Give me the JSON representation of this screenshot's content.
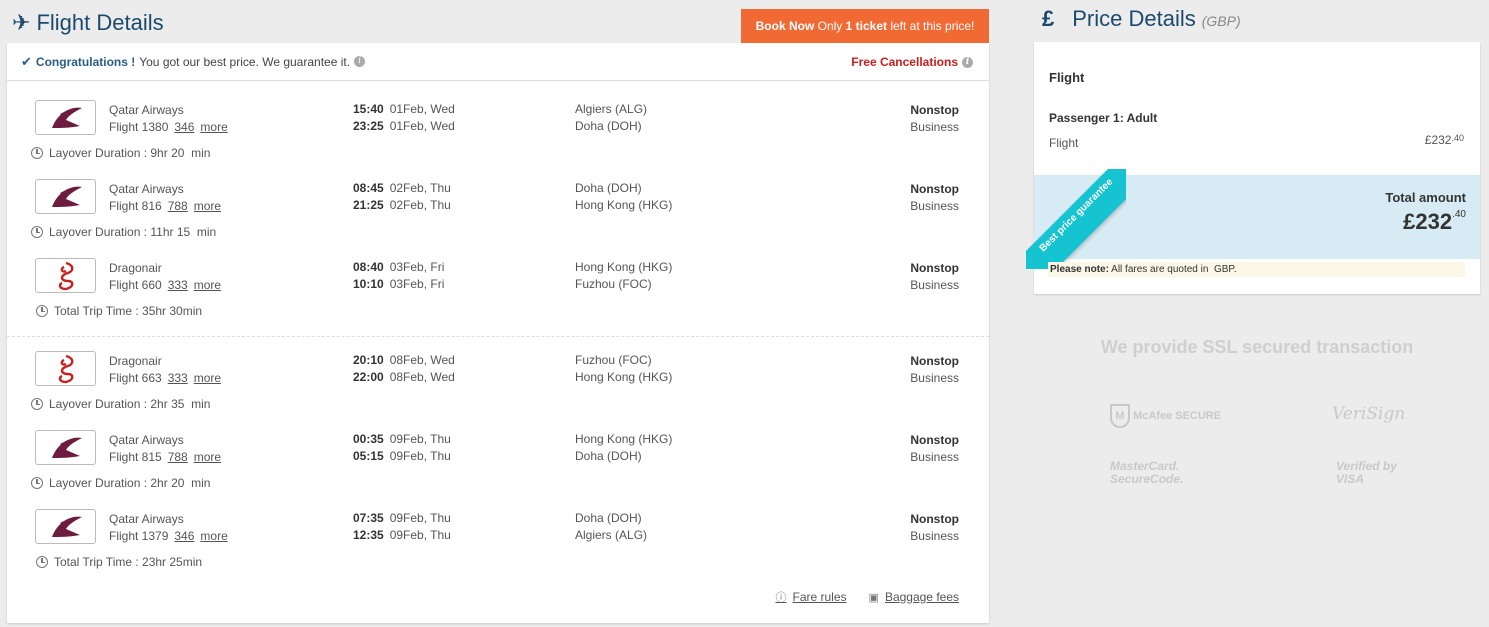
{
  "flight_details": {
    "title": "Flight Details",
    "book_now": {
      "bold": "Book Now",
      "text1": " Only ",
      "bold2": "1 ticket",
      "text2": " left at this price!"
    },
    "congrats": {
      "bold": "Congratulations !",
      "text": "You got our best price. We guarantee it."
    },
    "free_cancellations": "Free Cancellations",
    "segments": [
      {
        "airline": "Qatar Airways",
        "flight": "Flight 1380",
        "aircraft": "346",
        "more": "more",
        "dep_time": "15:40",
        "dep_date": "01Feb, Wed",
        "arr_time": "23:25",
        "arr_date": "01Feb, Wed",
        "from": "Algiers (ALG)",
        "to": "Doha (DOH)",
        "stops": "Nonstop",
        "cabin": "Business",
        "after": "Layover Duration : 9hr 20  min"
      },
      {
        "airline": "Qatar Airways",
        "flight": "Flight 816",
        "aircraft": "788",
        "more": "more",
        "dep_time": "08:45",
        "dep_date": "02Feb, Thu",
        "arr_time": "21:25",
        "arr_date": "02Feb, Thu",
        "from": "Doha (DOH)",
        "to": "Hong Kong (HKG)",
        "stops": "Nonstop",
        "cabin": "Business",
        "after": "Layover Duration : 11hr 15  min"
      },
      {
        "airline": "Dragonair",
        "flight": "Flight 660",
        "aircraft": "333",
        "more": "more",
        "dep_time": "08:40",
        "dep_date": "03Feb, Fri",
        "arr_time": "10:10",
        "arr_date": "03Feb, Fri",
        "from": "Hong Kong (HKG)",
        "to": "Fuzhou (FOC)",
        "stops": "Nonstop",
        "cabin": "Business",
        "after": "Total Trip Time : 35hr 30min"
      },
      {
        "airline": "Dragonair",
        "flight": "Flight 663",
        "aircraft": "333",
        "more": "more",
        "dep_time": "20:10",
        "dep_date": "08Feb, Wed",
        "arr_time": "22:00",
        "arr_date": "08Feb, Wed",
        "from": "Fuzhou (FOC)",
        "to": "Hong Kong (HKG)",
        "stops": "Nonstop",
        "cabin": "Business",
        "after": "Layover Duration : 2hr 35  min"
      },
      {
        "airline": "Qatar Airways",
        "flight": "Flight 815",
        "aircraft": "788",
        "more": "more",
        "dep_time": "00:35",
        "dep_date": "09Feb, Thu",
        "arr_time": "05:15",
        "arr_date": "09Feb, Thu",
        "from": "Hong Kong (HKG)",
        "to": "Doha (DOH)",
        "stops": "Nonstop",
        "cabin": "Business",
        "after": "Layover Duration : 2hr 20  min"
      },
      {
        "airline": "Qatar Airways",
        "flight": "Flight 1379",
        "aircraft": "346",
        "more": "more",
        "dep_time": "07:35",
        "dep_date": "09Feb, Thu",
        "arr_time": "12:35",
        "arr_date": "09Feb, Thu",
        "from": "Doha (DOH)",
        "to": "Algiers (ALG)",
        "stops": "Nonstop",
        "cabin": "Business",
        "after": "Total Trip Time : 23hr 25min"
      }
    ],
    "fare_rules": "Fare rules",
    "baggage_fees": "Baggage fees"
  },
  "price_details": {
    "symbol": "£",
    "title": "Price Details",
    "currency": "(GBP)",
    "flight_label": "Flight",
    "passenger_label": "Passenger 1: Adult",
    "line_label": "Flight",
    "line_amount": "£232",
    "line_amount_dec": ".40",
    "ribbon": "Best price guarantee",
    "total_label": "Total amount",
    "total_amount": "£232",
    "total_amount_dec": ".40",
    "note_bold": "Please note:",
    "note_text": " All fares are quoted in  GBP."
  },
  "security": {
    "heading": "We provide SSL secured transaction",
    "badges": [
      "McAfee SECURE",
      "VeriSign",
      "MasterCard. SecureCode.",
      "Verified by VISA"
    ]
  },
  "colors": {
    "accent": "#1a4a6e",
    "cta": "#f26a33",
    "red": "#c8201e",
    "ribbon": "#16c3d1",
    "total_bg": "#d7ebf4"
  }
}
